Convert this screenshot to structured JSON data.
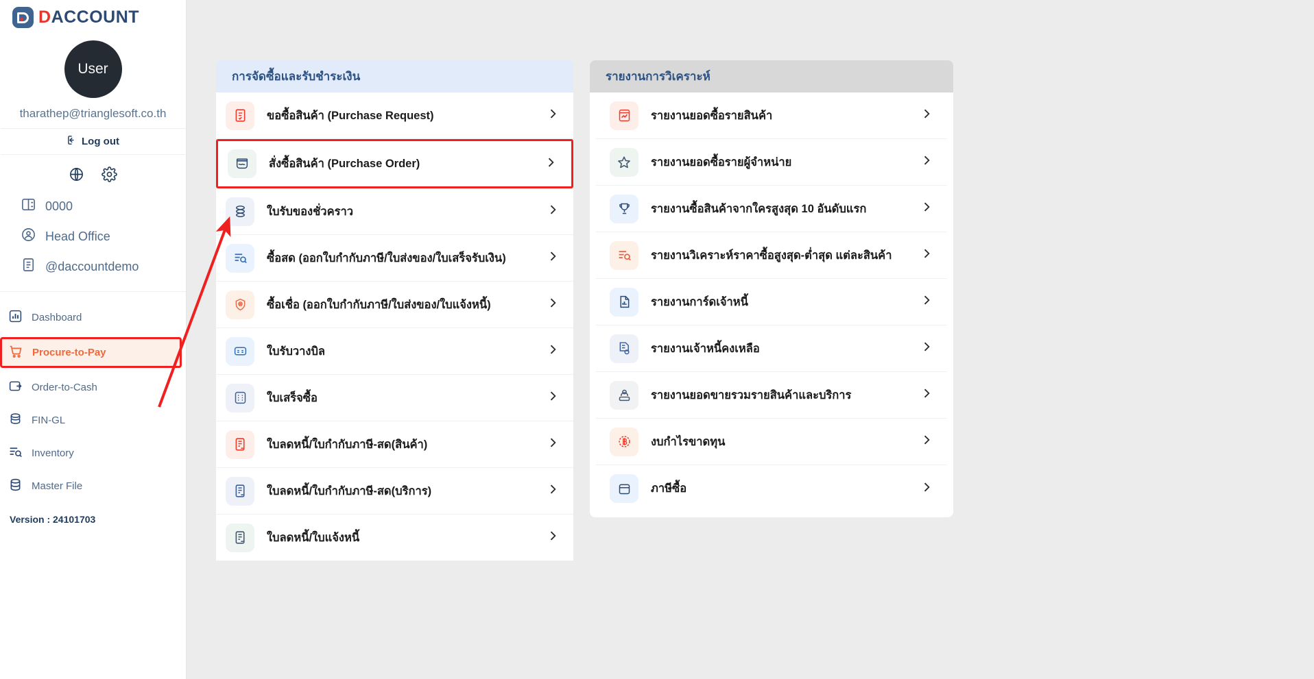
{
  "brand": {
    "logo_red": "D",
    "logo_blue": "ACCOUNT",
    "accent_red": "#e8342a",
    "accent_blue": "#2e4a72",
    "highlight_red": "#ef2020"
  },
  "sidebar": {
    "avatar_label": "User",
    "user_email": "tharathep@trianglesoft.co.th",
    "logout_label": "Log out",
    "quick_icons": [
      {
        "name": "globe-icon"
      },
      {
        "name": "gear-icon"
      }
    ],
    "meta_items": [
      {
        "label": "0000",
        "icon": "book-icon"
      },
      {
        "label": "Head Office",
        "icon": "user-circle-icon"
      },
      {
        "label": "@daccountdemo",
        "icon": "document-icon"
      }
    ],
    "nav_items": [
      {
        "label": "Dashboard",
        "icon": "chart-bar-icon",
        "active": false
      },
      {
        "label": "Procure-to-Pay",
        "icon": "shopping-cart-icon",
        "active": true
      },
      {
        "label": "Order-to-Cash",
        "icon": "wallet-icon",
        "active": false
      },
      {
        "label": "FIN-GL",
        "icon": "coins-icon",
        "active": false
      },
      {
        "label": "Inventory",
        "icon": "list-search-icon",
        "active": false
      },
      {
        "label": "Master File",
        "icon": "database-icon",
        "active": false
      }
    ],
    "version": "Version : 24101703"
  },
  "panels": {
    "left": {
      "title": "การจัดซื้อและรับชำระเงิน",
      "header_bg": "#e1ebfa",
      "items": [
        {
          "label": "ขอซื้อสินค้า (Purchase Request)",
          "icon": "document-check-icon",
          "tint": "bg-red",
          "highlighted": false
        },
        {
          "label": "สั่งซื้อสินค้า (Purchase Order)",
          "icon": "purchase-order-icon",
          "tint": "bg-green",
          "highlighted": true
        },
        {
          "label": "ใบรับของชั่วคราว",
          "icon": "stack-icon",
          "tint": "bg-slate",
          "highlighted": false
        },
        {
          "label": "ซื้อสด (ออกใบกำกับภาษี/ใบส่งของ/ใบเสร็จรับเงิน)",
          "icon": "list-search-icon",
          "tint": "bg-blue",
          "highlighted": false
        },
        {
          "label": "ซื้อเชื่อ (ออกใบกำกับภาษี/ใบส่งของ/ใบแจ้งหนี้)",
          "icon": "credit-badge-icon",
          "tint": "bg-orange",
          "highlighted": false
        },
        {
          "label": "ใบรับวางบิล",
          "icon": "billing-card-icon",
          "tint": "bg-blue",
          "highlighted": false
        },
        {
          "label": "ใบเสร็จซื้อ",
          "icon": "receipt-calc-icon",
          "tint": "bg-slate",
          "highlighted": false
        },
        {
          "label": "ใบลดหนี้/ใบกำกับภาษี-สด(สินค้า)",
          "icon": "credit-note-icon",
          "tint": "bg-red",
          "highlighted": false
        },
        {
          "label": "ใบลดหนี้/ใบกำกับภาษี-สด(บริการ)",
          "icon": "credit-note-icon",
          "tint": "bg-slate",
          "highlighted": false
        },
        {
          "label": "ใบลดหนี้/ใบแจ้งหนี้",
          "icon": "credit-note-icon",
          "tint": "bg-green",
          "highlighted": false
        }
      ]
    },
    "right": {
      "title": "รายงานการวิเคราะห์",
      "header_bg": "#d8d8d8",
      "items": [
        {
          "label": "รายงานยอดซื้อรายสินค้า",
          "icon": "report-chart-icon",
          "tint": "bg-red"
        },
        {
          "label": "รายงานยอดซื้อรายผู้จำหน่าย",
          "icon": "star-icon",
          "tint": "bg-green"
        },
        {
          "label": "รายงานซื้อสินค้าจากใครสูงสุด 10 อันดับแรก",
          "icon": "trophy-icon",
          "tint": "bg-blue"
        },
        {
          "label": "รายงานวิเคราะห์ราคาซื้อสูงสุด-ต่ำสุด แต่ละสินค้า",
          "icon": "list-search-icon",
          "tint": "bg-orange"
        },
        {
          "label": "รายงานการ์ดเจ้าหนี้",
          "icon": "document-chart-icon",
          "tint": "bg-blue"
        },
        {
          "label": "รายงานเจ้าหนี้คงเหลือ",
          "icon": "document-cloud-icon",
          "tint": "bg-slate"
        },
        {
          "label": "รายงานยอดขายรวมรายสินค้าและบริการ",
          "icon": "inbox-person-icon",
          "tint": "bg-gray"
        },
        {
          "label": "งบกำไรขาดทุน",
          "icon": "baht-circle-icon",
          "tint": "bg-orange"
        },
        {
          "label": "ภาษีซื้อ",
          "icon": "tax-box-icon",
          "tint": "bg-blue"
        }
      ]
    }
  }
}
